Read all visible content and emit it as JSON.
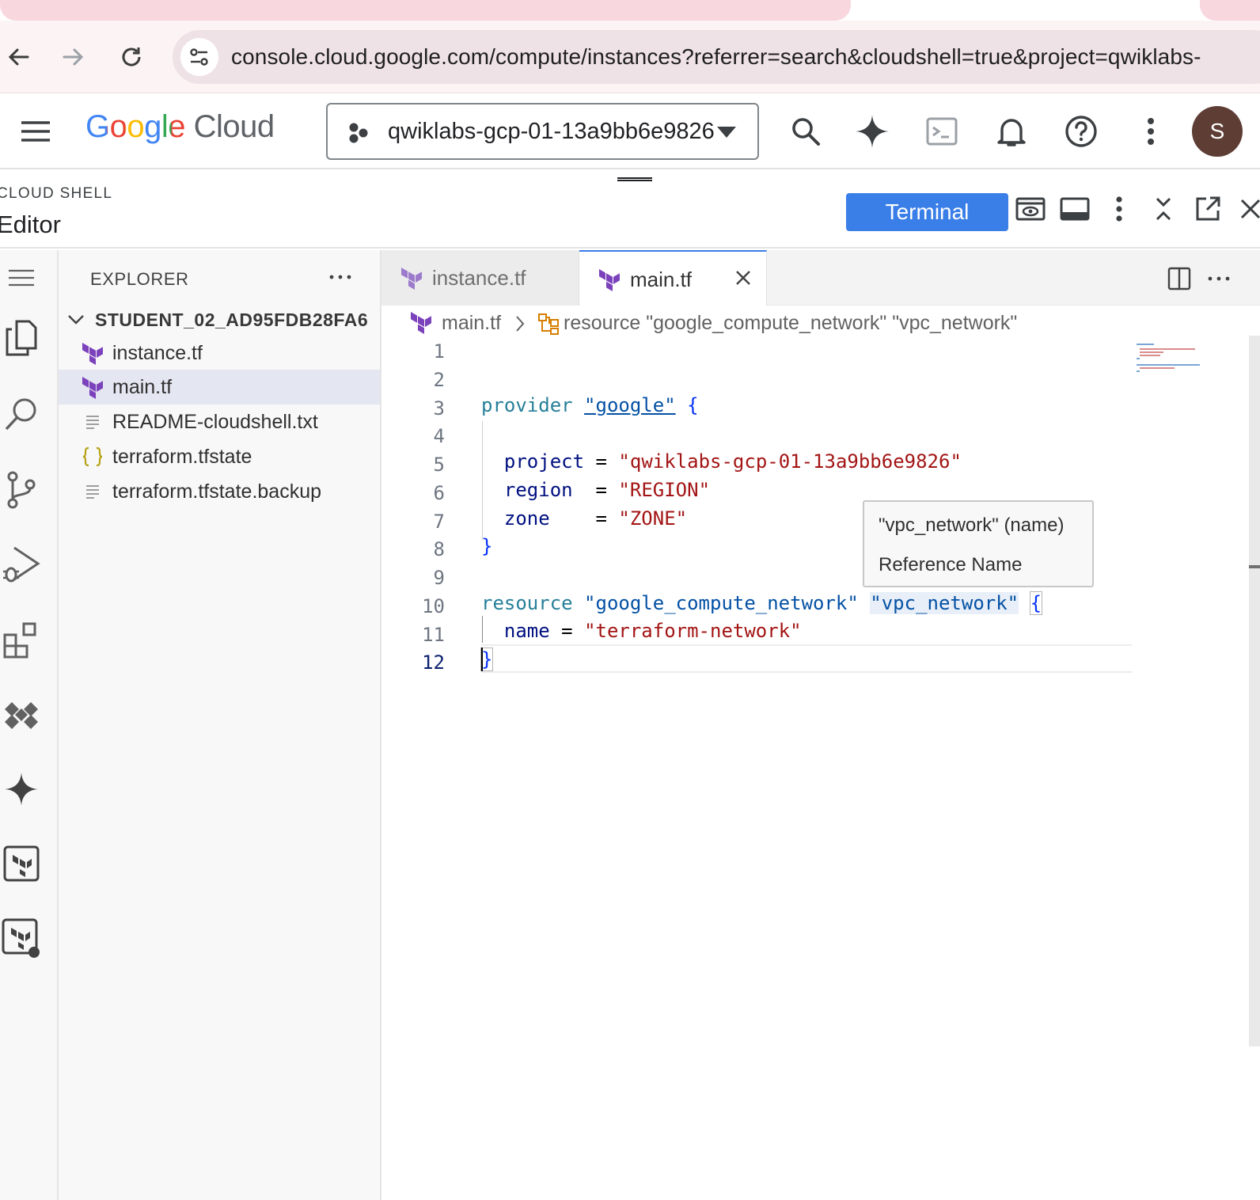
{
  "browser": {
    "url": "console.cloud.google.com/compute/instances?referrer=search&cloudshell=true&project=qwiklabs-"
  },
  "header": {
    "logo_google": "Google",
    "logo_cloud": "Cloud",
    "project": "qwiklabs-gcp-01-13a9bb6e9826",
    "avatar_initial": "S"
  },
  "shell": {
    "label": "CLOUD SHELL",
    "title": "Editor",
    "terminal_button": "Terminal"
  },
  "explorer": {
    "title": "EXPLORER",
    "folder": "STUDENT_02_AD95FDB28FA6",
    "files": [
      {
        "name": "instance.tf",
        "icon": "terraform-icon"
      },
      {
        "name": "main.tf",
        "icon": "terraform-icon",
        "active": true
      },
      {
        "name": "README-cloudshell.txt",
        "icon": "text-file-icon"
      },
      {
        "name": "terraform.tfstate",
        "icon": "json-braces-icon"
      },
      {
        "name": "terraform.tfstate.backup",
        "icon": "text-file-icon"
      }
    ]
  },
  "tabs": [
    {
      "label": "instance.tf",
      "active": false
    },
    {
      "label": "main.tf",
      "active": true
    }
  ],
  "breadcrumb": {
    "file": "main.tf",
    "symbol": "resource \"google_compute_network\" \"vpc_network\""
  },
  "code": {
    "line_numbers": [
      "1",
      "2",
      "3",
      "4",
      "5",
      "6",
      "7",
      "8",
      "9",
      "10",
      "11",
      "12"
    ],
    "current_line": "12",
    "t_provider": "provider",
    "t_google": "\"google\"",
    "t_lbrace": "{",
    "t_rbrace": "}",
    "t_project": "project",
    "t_region": "region",
    "t_zone": "zone",
    "t_eq": "=",
    "v_project": "\"qwiklabs-gcp-01-13a9bb6e9826\"",
    "v_region": "\"REGION\"",
    "v_zone": "\"ZONE\"",
    "t_resource": "resource",
    "t_type": "\"google_compute_network\"",
    "t_rname": "\"vpc_network\"",
    "t_name": "name",
    "v_name": "\"terraform-network\""
  },
  "hover": {
    "line1": "\"vpc_network\" (name)",
    "line2": "Reference Name"
  },
  "colors": {
    "terminal_button": "#3a7ee8",
    "tab_strip": "#f8d7de",
    "avatar": "#5d3d34",
    "terraform_purple": "#7b42bc"
  }
}
